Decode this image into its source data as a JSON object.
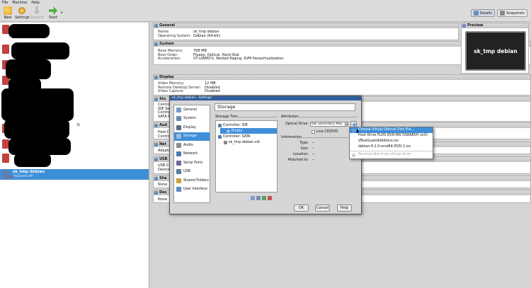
{
  "menubar": {
    "items": [
      "File",
      "Machine",
      "Help"
    ]
  },
  "toolbar": {
    "new": "New",
    "settings": "Settings",
    "discard": "Discard",
    "start": "Start",
    "details": "Details",
    "snapshots": "Snapshots"
  },
  "vmlist": {
    "selected": {
      "name": "sk_tmp debian",
      "state": "Powered Off"
    },
    "partial": "3)"
  },
  "general": {
    "title": "General",
    "name_k": "Name:",
    "name_v": "sk_tmp debian",
    "os_k": "Operating System:",
    "os_v": "Debian (64-bit)"
  },
  "system": {
    "title": "System",
    "mem_k": "Base Memory:",
    "mem_v": "768 MB",
    "boot_k": "Boot Order:",
    "boot_v": "Floppy, Optical, Hard Disk",
    "acc_k": "Acceleration:",
    "acc_v": "VT-x/AMD-V, Nested Paging, KVM Paravirtualization"
  },
  "display": {
    "title": "Display",
    "vm_k": "Video Memory:",
    "vm_v": "12 MB",
    "rds_k": "Remote Desktop Server:",
    "rds_v": "Disabled",
    "vc_k": "Video Capture:",
    "vc_v": "Disabled"
  },
  "preview": {
    "title": "Preview",
    "screen": "sk_tmp debian"
  },
  "peek": {
    "storage": "Sto",
    "controller": "Controll",
    "ide_sec": "IDE Se",
    "controller2": "Controll",
    "sata": "SATA P",
    "audio": "Aud",
    "host_drv": "Host Dri",
    "controller3": "Controll",
    "network": "Net",
    "adapter": "Adapter",
    "usb": "USB",
    "usb_ctrl": "USB Con",
    "dev_filter": "Device F",
    "shared": "Sha",
    "none1": "None",
    "desc": "Des",
    "none2": "None"
  },
  "dialog": {
    "title": "sk_tmp debian - Settings",
    "categories": [
      "General",
      "System",
      "Display",
      "Storage",
      "Audio",
      "Network",
      "Serial Ports",
      "USB",
      "Shared Folders",
      "User Interface"
    ],
    "page_title": "Storage",
    "storage_tree_label": "Storage Tree",
    "tree": {
      "ide": "Controller: IDE",
      "empty": "Empty",
      "sata": "Controller: SATA",
      "vdi": "sk_tmp debian.vdi"
    },
    "attributes": "Attributes",
    "optical_label": "Optical Drive:",
    "optical_value": "IDE Secondary Mas",
    "live_cd": "Live CD/DVD",
    "information": "Information",
    "info": {
      "type_k": "Type:",
      "type_v": "--",
      "size_k": "Size:",
      "size_v": "--",
      "loc_k": "Location:",
      "loc_v": "--",
      "att_k": "Attached to:",
      "att_v": "--"
    },
    "ok": "OK",
    "cancel": "Cancel",
    "help": "Help"
  },
  "dropdown": {
    "items": [
      "Choose Virtual Optical Disk File...",
      "Host Drive PLDS DVD-RW DS8A8SH  (sr0)",
      "VBoxGuestAdditions.iso",
      "debian-8.2.0-amd64-DVD-1.iso",
      "Remove disk from virtual drive"
    ]
  }
}
